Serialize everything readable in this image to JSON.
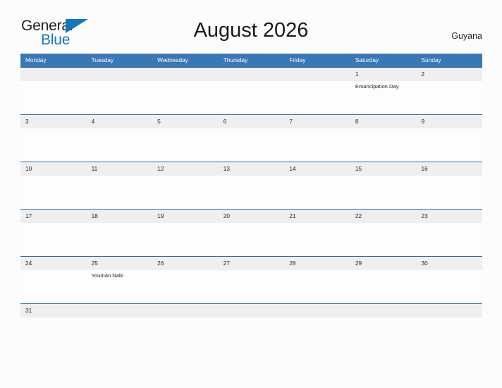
{
  "brand": {
    "word_one": "General",
    "word_two": "Blue",
    "flag_icon": "flag-triangle-icon",
    "color_dark": "#231f20",
    "color_blue": "#1278be"
  },
  "header": {
    "title": "August 2026",
    "country": "Guyana"
  },
  "theme": {
    "header_blue": "#3a78b5",
    "row_border_blue": "#2e6da4",
    "date_band_gray": "#efefef",
    "page_background": "#fcfcfc"
  },
  "calendar": {
    "weekdays": [
      "Monday",
      "Tuesday",
      "Wednesday",
      "Thursday",
      "Friday",
      "Saturday",
      "Sunday"
    ],
    "weeks": [
      {
        "days": [
          {
            "date": "",
            "event": ""
          },
          {
            "date": "",
            "event": ""
          },
          {
            "date": "",
            "event": ""
          },
          {
            "date": "",
            "event": ""
          },
          {
            "date": "",
            "event": ""
          },
          {
            "date": "1",
            "event": "Emancipation Day"
          },
          {
            "date": "2",
            "event": ""
          }
        ]
      },
      {
        "days": [
          {
            "date": "3",
            "event": ""
          },
          {
            "date": "4",
            "event": ""
          },
          {
            "date": "5",
            "event": ""
          },
          {
            "date": "6",
            "event": ""
          },
          {
            "date": "7",
            "event": ""
          },
          {
            "date": "8",
            "event": ""
          },
          {
            "date": "9",
            "event": ""
          }
        ]
      },
      {
        "days": [
          {
            "date": "10",
            "event": ""
          },
          {
            "date": "11",
            "event": ""
          },
          {
            "date": "12",
            "event": ""
          },
          {
            "date": "13",
            "event": ""
          },
          {
            "date": "14",
            "event": ""
          },
          {
            "date": "15",
            "event": ""
          },
          {
            "date": "16",
            "event": ""
          }
        ]
      },
      {
        "days": [
          {
            "date": "17",
            "event": ""
          },
          {
            "date": "18",
            "event": ""
          },
          {
            "date": "19",
            "event": ""
          },
          {
            "date": "20",
            "event": ""
          },
          {
            "date": "21",
            "event": ""
          },
          {
            "date": "22",
            "event": ""
          },
          {
            "date": "23",
            "event": ""
          }
        ]
      },
      {
        "days": [
          {
            "date": "24",
            "event": ""
          },
          {
            "date": "25",
            "event": "Youman Nabi"
          },
          {
            "date": "26",
            "event": ""
          },
          {
            "date": "27",
            "event": ""
          },
          {
            "date": "28",
            "event": ""
          },
          {
            "date": "29",
            "event": ""
          },
          {
            "date": "30",
            "event": ""
          }
        ]
      },
      {
        "last": true,
        "days": [
          {
            "date": "31",
            "event": ""
          },
          {
            "date": "",
            "event": ""
          },
          {
            "date": "",
            "event": ""
          },
          {
            "date": "",
            "event": ""
          },
          {
            "date": "",
            "event": ""
          },
          {
            "date": "",
            "event": ""
          },
          {
            "date": "",
            "event": ""
          }
        ]
      }
    ]
  }
}
